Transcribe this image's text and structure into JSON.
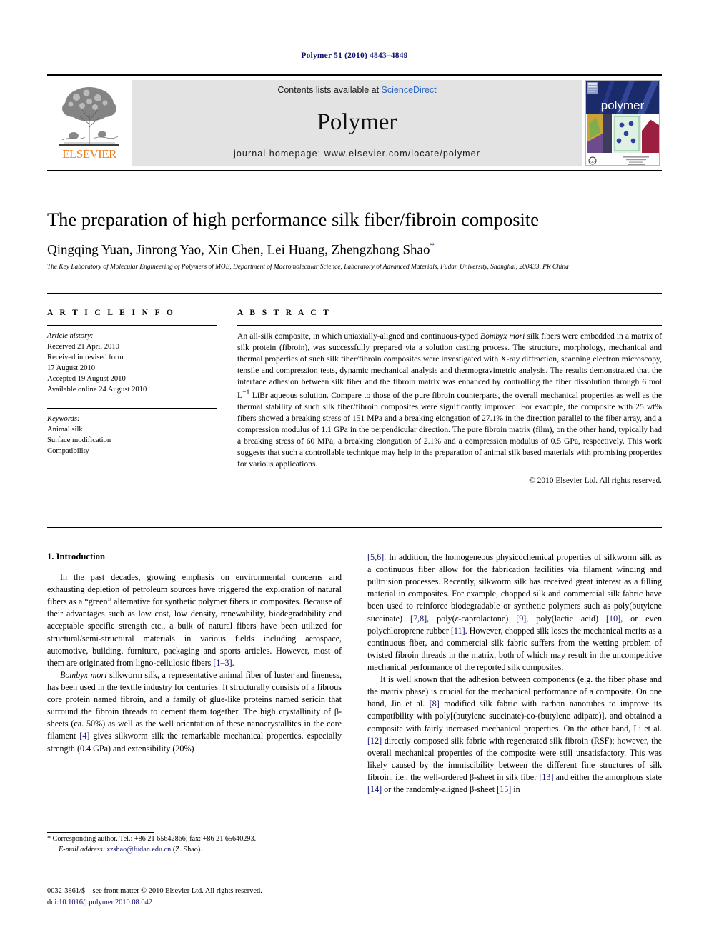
{
  "running_head": "Polymer 51 (2010) 4843–4849",
  "header": {
    "contents_prefix": "Contents lists available at ",
    "sciencedirect": "ScienceDirect",
    "journal_title": "Polymer",
    "homepage": "journal homepage: www.elsevier.com/locate/polymer",
    "publisher_name": "ELSEVIER",
    "cover_word": "polymer",
    "accent_orange": "#f07d1a",
    "link_blue": "#2b66c4",
    "navy": "#10106b"
  },
  "article": {
    "title": "The preparation of high performance silk fiber/fibroin composite",
    "authors": "Qingqing Yuan, Jinrong Yao, Xin Chen, Lei Huang, Zhengzhong Shao",
    "corresponding_marker": "*",
    "affiliation": "The Key Laboratory of Molecular Engineering of Polymers of MOE, Department of Macromolecular Science, Laboratory of Advanced Materials, Fudan University, Shanghai, 200433, PR China"
  },
  "info": {
    "heading": "A R T I C L E  I N F O",
    "history_label": "Article history:",
    "history": [
      "Received 21 April 2010",
      "Received in revised form",
      "17 August 2010",
      "Accepted 19 August 2010",
      "Available online 24 August 2010"
    ],
    "keywords_label": "Keywords:",
    "keywords": [
      "Animal silk",
      "Surface modification",
      "Compatibility"
    ]
  },
  "abstract": {
    "heading": "A B S T R A C T",
    "part1": "An all-silk composite, in which uniaxially-aligned and continuous-typed ",
    "italic1": "Bombyx mori",
    "part2": " silk fibers were embedded in a matrix of silk protein (fibroin), was successfully prepared via a solution casting process. The structure, morphology, mechanical and thermal properties of such silk fiber/fibroin composites were investigated with X-ray diffraction, scanning electron microscopy, tensile and compression tests, dynamic mechanical analysis and thermogravimetric analysis. The results demonstrated that the interface adhesion between silk fiber and the fibroin matrix was enhanced by controlling the fiber dissolution through 6 mol L",
    "sup1": "−1",
    "part3": " LiBr aqueous solution. Compare to those of the pure fibroin counterparts, the overall mechanical properties as well as the thermal stability of such silk fiber/fibroin composites were significantly improved. For example, the composite with 25 wt% fibers showed a breaking stress of 151 MPa and a breaking elongation of 27.1% in the direction parallel to the fiber array, and a compression modulus of 1.1 GPa in the perpendicular direction. The pure fibroin matrix (film), on the other hand, typically had a breaking stress of 60 MPa, a breaking elongation of 2.1% and a compression modulus of 0.5 GPa, respectively. This work suggests that such a controllable technique may help in the preparation of animal silk based materials with promising properties for various applications.",
    "copyright": "© 2010 Elsevier Ltd. All rights reserved."
  },
  "intro": {
    "heading": "1. Introduction",
    "left_p1_a": "In the past decades, growing emphasis on environmental concerns and exhausting depletion of petroleum sources have triggered the exploration of natural fibers as a “green” alternative for synthetic polymer fibers in composites. Because of their advantages such as low cost, low density, renewability, biodegradability and acceptable specific strength etc., a bulk of natural fibers have been utilized for structural/semi-structural materials in various fields including aerospace, automotive, building, furniture, packaging and sports articles. However, most of them are originated from ligno-cellulosic fibers ",
    "left_p1_ref": "[1–3]",
    "left_p1_b": ".",
    "left_p2_italic": "Bombyx mori",
    "left_p2_a": " silkworm silk, a representative animal fiber of luster and fineness, has been used in the textile industry for centuries. It structurally consists of a fibrous core protein named fibroin, and a family of glue-like proteins named sericin that surround the fibroin threads to cement them together. The high crystallinity of β-sheets (ca. 50%) as well as the well orientation of these nanocrystallites in the core filament ",
    "left_p2_ref": "[4]",
    "left_p2_b": " gives silkworm silk the remarkable mechanical properties, especially strength (0.4 GPa) and extensibility (20%)",
    "right_p1_ref1": "[5,6]",
    "right_p1_a": ". In addition, the homogeneous physicochemical properties of silkworm silk as a continuous fiber allow for the fabrication facilities via filament winding and pultrusion processes. Recently, silkworm silk has received great interest as a filling material in composites. For example, chopped silk and commercial silk fabric have been used to reinforce biodegradable or synthetic polymers such as poly(butylene succinate) ",
    "right_p1_ref2": "[7,8]",
    "right_p1_b": ", poly(",
    "right_p1_eps": "ε",
    "right_p1_c": "-caprolactone) ",
    "right_p1_ref3": "[9]",
    "right_p1_d": ", poly(lactic acid) ",
    "right_p1_ref4": "[10]",
    "right_p1_e": ", or even polychloroprene rubber ",
    "right_p1_ref5": "[11]",
    "right_p1_f": ". However, chopped silk loses the mechanical merits as a continuous fiber, and commercial silk fabric suffers from the wetting problem of twisted fibroin threads in the matrix, both of which may result in the uncompetitive mechanical performance of the reported silk composites.",
    "right_p2_a": "It is well known that the adhesion between components (e.g. the fiber phase and the matrix phase) is crucial for the mechanical performance of a composite. On one hand, Jin et al. ",
    "right_p2_ref1": "[8]",
    "right_p2_b": " modified silk fabric with carbon nanotubes to improve its compatibility with poly[(butylene succinate)-co-(butylene adipate)], and obtained a composite with fairly increased mechanical properties. On the other hand, Li et al. ",
    "right_p2_ref2": "[12]",
    "right_p2_c": " directly composed silk fabric with regenerated silk fibroin (RSF); however, the overall mechanical properties of the composite were still unsatisfactory. This was likely caused by the immiscibility between the different fine structures of silk fibroin, i.e., the well-ordered β-sheet in silk fiber ",
    "right_p2_ref3": "[13]",
    "right_p2_d": " and either the amorphous state ",
    "right_p2_ref4": "[14]",
    "right_p2_e": " or the randomly-aligned β-sheet ",
    "right_p2_ref5": "[15]",
    "right_p2_f": " in"
  },
  "footer": {
    "corr_marker": "*",
    "corr_text": " Corresponding author. Tel.: +86 21 65642866; fax: +86 21 65640293.",
    "email_label": "E-mail address:",
    "email": "zzshao@fudan.edu.cn",
    "email_suffix": " (Z. Shao).",
    "issn_line": "0032-3861/$ – see front matter © 2010 Elsevier Ltd. All rights reserved.",
    "doi_label": "doi:",
    "doi": "10.1016/j.polymer.2010.08.042"
  }
}
